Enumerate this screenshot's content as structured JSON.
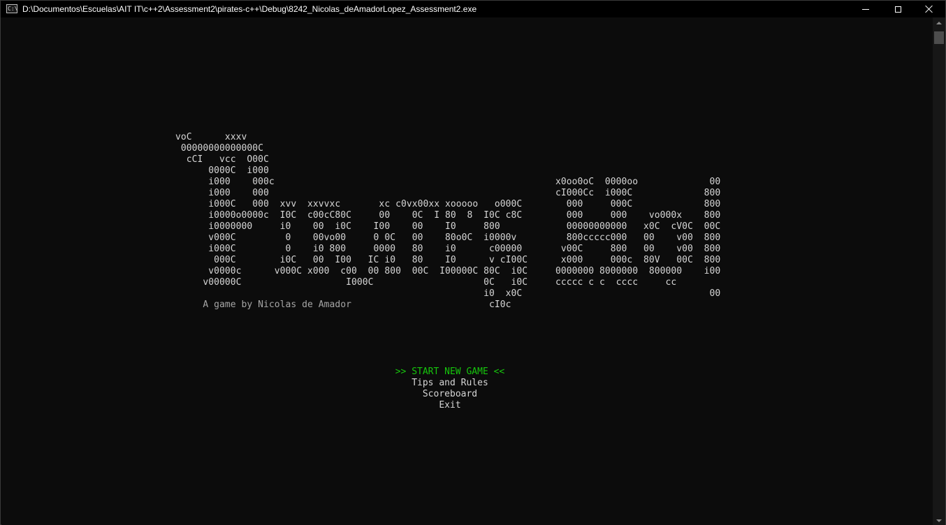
{
  "window": {
    "title": "D:\\Documentos\\Escuelas\\AIT IT\\c++2\\Assessment2\\pirates-c++\\Debug\\8242_Nicolas_deAmadorLopez_Assessment2.exe",
    "icon_label": "C:\\"
  },
  "art": {
    "ship_lines": [
      "voC      xxxv",
      " 00000000000000C",
      "  cCI   vcc  O00C",
      "      0000C  i000",
      "      i000    000c",
      "      i000    000",
      "      i000C   000  xvv  xxvvxc       xc c0vx00xx xooooo   o000C",
      "      i0000o0000c  I0C  c00cC80C     00    0C  I 80  8  I0C c8C",
      "      i0000000     i0    00  i0C    I00    00    I0     800",
      "      v000C         0    00vo00     0 0C   00    80o0C  i0000v",
      "      i000C         0    i0 800     0000   80    i0      c00000",
      "       000C        i0C   00  I00   IC i0   80    I0      v cI00C",
      "      v0000c      v000C x000  c00  00 800  00C  I00000C 80C  i0C",
      "     v00000C                   I000C                    0C   i0C",
      "                                                        i0  x0C",
      "     A game by Nicolas de Amador                         cI0c"
    ],
    "tagline_line_index": 15,
    "right_lines": [
      "x0oo0oC  0000oo             00",
      "cI000Cc  i000C             800",
      "  000     000C             800",
      "  000     000    vo000x    800",
      "  00000000000   x0C  cV0C  00C",
      "  800ccccc000   00    v00  800",
      " v00C     800   00    v00  800",
      " x000     000c  80V   00C  800",
      "0000000 8000000  800000    i00",
      "ccccc c c  cccc     cc",
      "                            00"
    ]
  },
  "menu": {
    "items": [
      {
        "label": ">> START NEW GAME <<",
        "selected": true
      },
      {
        "label": "Tips and Rules",
        "selected": false
      },
      {
        "label": "Scoreboard",
        "selected": false
      },
      {
        "label": "Exit",
        "selected": false
      }
    ],
    "selected_color": "#16c60c",
    "text_color": "#d6d6d6"
  },
  "colors": {
    "background": "#0c0c0c",
    "titlebar": "#000000",
    "dim_text": "#a6a6a6"
  }
}
